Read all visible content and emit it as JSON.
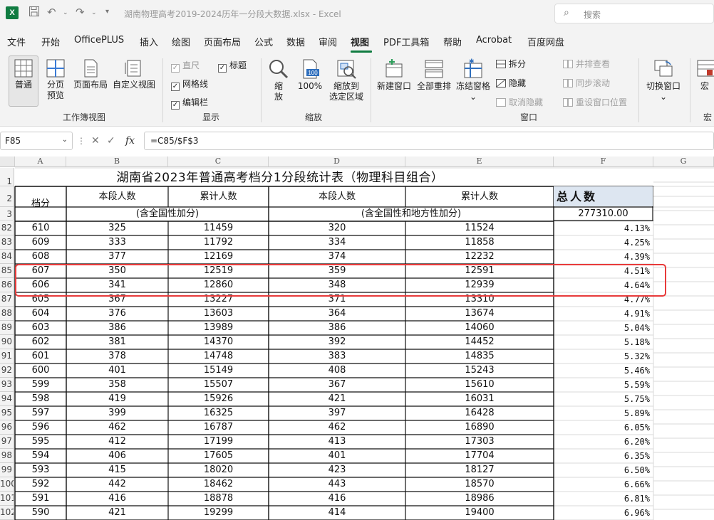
{
  "titlebar": {
    "logo": "X",
    "doc_title": "湖南物理高考2019-2024历年一分段大数据.xlsx  -  Excel",
    "search_placeholder": "搜索"
  },
  "menu": [
    "文件",
    "开始",
    "OfficePLUS",
    "插入",
    "绘图",
    "页面布局",
    "公式",
    "数据",
    "审阅",
    "视图",
    "PDF工具箱",
    "帮助",
    "Acrobat",
    "百度网盘"
  ],
  "ribbon": {
    "g1": {
      "label": "工作簿视图",
      "normal": "普通",
      "pagebreak_1": "分页",
      "pagebreak_2": "预览",
      "pagelayout": "页面布局",
      "custom": "自定义视图"
    },
    "g2": {
      "label": "显示",
      "ruler": "直尺",
      "gridlines": "网格线",
      "formulabar": "编辑栏",
      "headings": "标题"
    },
    "g3": {
      "label": "缩放",
      "zoom_1": "缩",
      "zoom_2": "放",
      "z100": "100%",
      "zsel_1": "缩放到",
      "zsel_2": "选定区域"
    },
    "g4": {
      "label": "窗口",
      "newwin": "新建窗口",
      "arrange": "全部重排",
      "freeze": "冻结窗格",
      "split": "拆分",
      "hide": "隐藏",
      "unhide": "取消隐藏",
      "sidebyside": "并排查看",
      "sync": "同步滚动",
      "reset": "重设窗口位置",
      "switch": "切换窗口"
    },
    "g5": {
      "label": "宏",
      "macro": "宏"
    }
  },
  "formula": {
    "cell_ref": "F85",
    "content": "=C85/$F$3",
    "fx": "fx"
  },
  "sheet": {
    "columns": [
      "A",
      "B",
      "C",
      "D",
      "E",
      "F",
      "G"
    ],
    "title": "湖南省2023年普通高考档分1分段统计表（物理科目组合）",
    "header": {
      "dangfen": "档分",
      "bdrs1": "本段人数",
      "ljrs1": "累计人数",
      "bdrs2": "本段人数",
      "ljrs2": "累计人数",
      "total_label": "总人数",
      "note1": "(含全国性加分)",
      "note2": "(含全国性和地方性加分)",
      "total_value": "277310.00"
    },
    "header_rows": [
      "1",
      "2",
      "3"
    ],
    "rows": [
      {
        "r": "82",
        "a": "610",
        "b": "325",
        "c": "11459",
        "d": "320",
        "e": "11524",
        "f": "4.13%"
      },
      {
        "r": "83",
        "a": "609",
        "b": "333",
        "c": "11792",
        "d": "334",
        "e": "11858",
        "f": "4.25%"
      },
      {
        "r": "84",
        "a": "608",
        "b": "377",
        "c": "12169",
        "d": "374",
        "e": "12232",
        "f": "4.39%"
      },
      {
        "r": "85",
        "a": "607",
        "b": "350",
        "c": "12519",
        "d": "359",
        "e": "12591",
        "f": "4.51%"
      },
      {
        "r": "86",
        "a": "606",
        "b": "341",
        "c": "12860",
        "d": "348",
        "e": "12939",
        "f": "4.64%"
      },
      {
        "r": "87",
        "a": "605",
        "b": "367",
        "c": "13227",
        "d": "371",
        "e": "13310",
        "f": "4.77%"
      },
      {
        "r": "88",
        "a": "604",
        "b": "376",
        "c": "13603",
        "d": "364",
        "e": "13674",
        "f": "4.91%"
      },
      {
        "r": "89",
        "a": "603",
        "b": "386",
        "c": "13989",
        "d": "386",
        "e": "14060",
        "f": "5.04%"
      },
      {
        "r": "90",
        "a": "602",
        "b": "381",
        "c": "14370",
        "d": "392",
        "e": "14452",
        "f": "5.18%"
      },
      {
        "r": "91",
        "a": "601",
        "b": "378",
        "c": "14748",
        "d": "383",
        "e": "14835",
        "f": "5.32%"
      },
      {
        "r": "92",
        "a": "600",
        "b": "401",
        "c": "15149",
        "d": "408",
        "e": "15243",
        "f": "5.46%"
      },
      {
        "r": "93",
        "a": "599",
        "b": "358",
        "c": "15507",
        "d": "367",
        "e": "15610",
        "f": "5.59%"
      },
      {
        "r": "94",
        "a": "598",
        "b": "419",
        "c": "15926",
        "d": "421",
        "e": "16031",
        "f": "5.75%"
      },
      {
        "r": "95",
        "a": "597",
        "b": "399",
        "c": "16325",
        "d": "397",
        "e": "16428",
        "f": "5.89%"
      },
      {
        "r": "96",
        "a": "596",
        "b": "462",
        "c": "16787",
        "d": "462",
        "e": "16890",
        "f": "6.05%"
      },
      {
        "r": "97",
        "a": "595",
        "b": "412",
        "c": "17199",
        "d": "413",
        "e": "17303",
        "f": "6.20%"
      },
      {
        "r": "98",
        "a": "594",
        "b": "406",
        "c": "17605",
        "d": "401",
        "e": "17704",
        "f": "6.35%"
      },
      {
        "r": "99",
        "a": "593",
        "b": "415",
        "c": "18020",
        "d": "423",
        "e": "18127",
        "f": "6.50%"
      },
      {
        "r": "100",
        "a": "592",
        "b": "442",
        "c": "18462",
        "d": "443",
        "e": "18570",
        "f": "6.66%"
      },
      {
        "r": "101",
        "a": "591",
        "b": "416",
        "c": "18878",
        "d": "416",
        "e": "18986",
        "f": "6.81%"
      },
      {
        "r": "102",
        "a": "590",
        "b": "421",
        "c": "19299",
        "d": "414",
        "e": "19400",
        "f": "6.96%"
      }
    ]
  },
  "colors": {
    "excel_green": "#107c41",
    "highlight_red": "#e83a3a",
    "total_fill": "#dde6f1"
  }
}
